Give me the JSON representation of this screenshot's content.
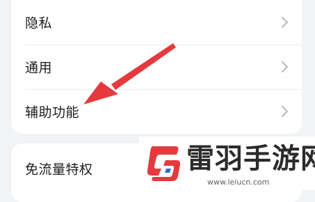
{
  "settings": {
    "items": [
      {
        "label": "隐私"
      },
      {
        "label": "通用"
      },
      {
        "label": "辅助功能"
      },
      {
        "label": "免流量特权"
      }
    ],
    "chevron_icon": "chevron-right-icon"
  },
  "annotation": {
    "arrow_color": "#e6393e",
    "points_to": "辅助功能"
  },
  "watermark": {
    "name": "雷羽手游网",
    "url": "www.leiucn.com",
    "logo_colors": [
      "#e6393e",
      "#2b6fd6"
    ]
  }
}
